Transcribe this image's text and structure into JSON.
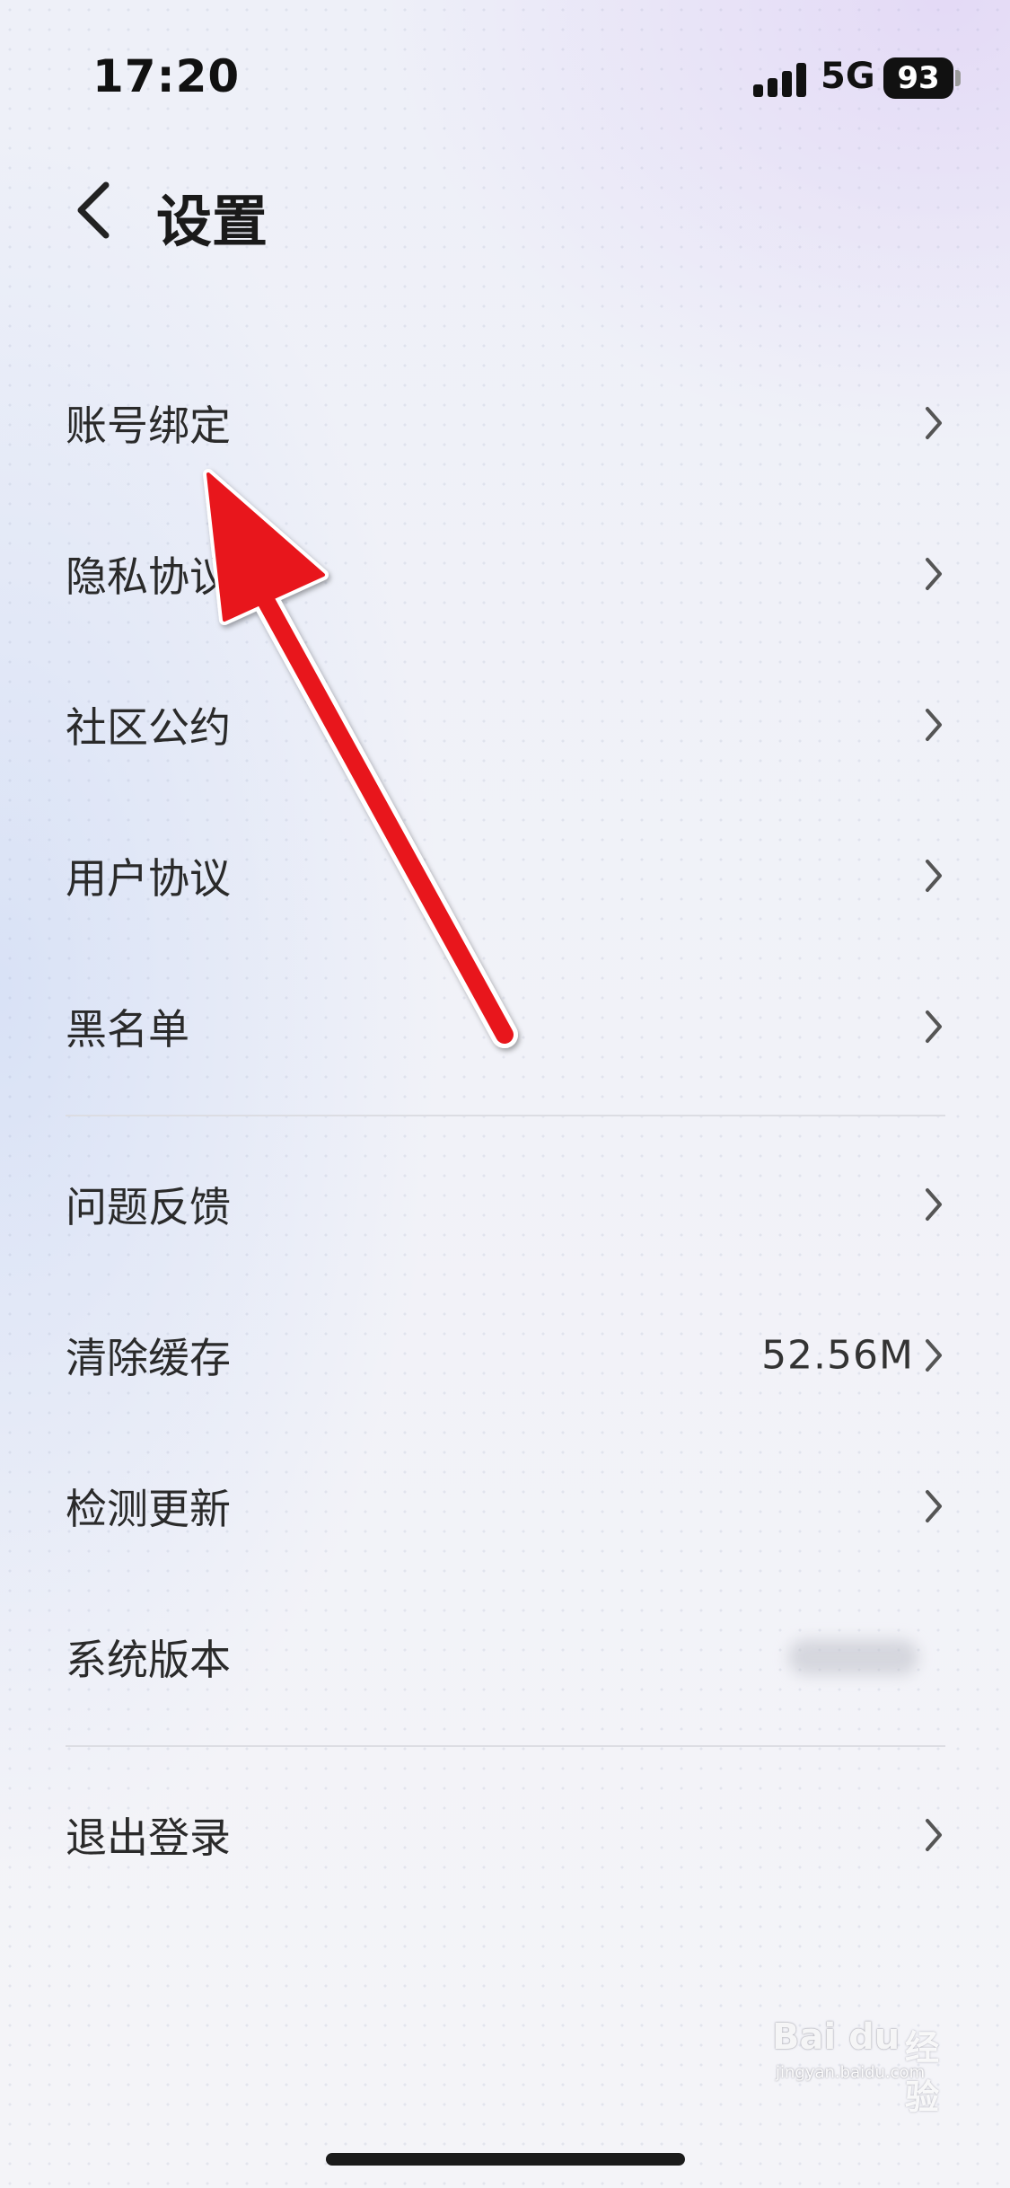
{
  "status_bar": {
    "time": "17:20",
    "network": "5G",
    "battery": "93"
  },
  "header": {
    "title": "设置",
    "back_icon": "chevron-left-icon"
  },
  "menu": {
    "group1": [
      {
        "label": "账号绑定"
      },
      {
        "label": "隐私协议"
      },
      {
        "label": "社区公约"
      },
      {
        "label": "用户协议"
      },
      {
        "label": "黑名单"
      }
    ],
    "group2": [
      {
        "label": "问题反馈"
      },
      {
        "label": "清除缓存",
        "value": "52.56M"
      },
      {
        "label": "检测更新"
      },
      {
        "label": "系统版本"
      }
    ],
    "group3": [
      {
        "label": "退出登录"
      }
    ]
  },
  "annotation": {
    "arrow_color": "#e8141b"
  },
  "watermark": {
    "brand": "Bai du",
    "brand_cn": "经验",
    "url": "jingyan.baidu.com"
  }
}
